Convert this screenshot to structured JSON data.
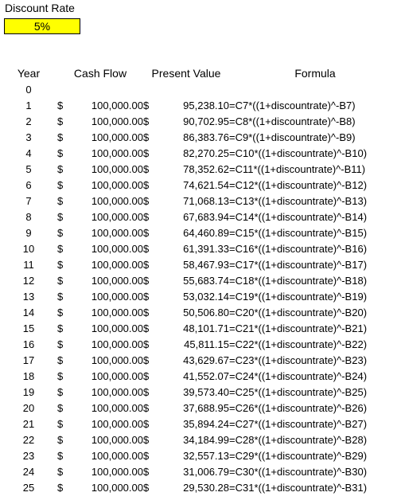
{
  "discount": {
    "label": "Discount Rate",
    "value": "5%",
    "cell_fill": "#ffff00",
    "cell_border": "#000000"
  },
  "table": {
    "headers": {
      "year": "Year",
      "cash_flow": "Cash Flow",
      "present_value": "Present Value",
      "formula": "Formula"
    },
    "currency_symbol": "$",
    "rows": [
      {
        "year": "0",
        "cash_flow": "",
        "present_value": "",
        "formula": ""
      },
      {
        "year": "1",
        "cash_flow": "100,000.00",
        "present_value": "95,238.10",
        "formula": "=C7*((1+discountrate)^-B7)"
      },
      {
        "year": "2",
        "cash_flow": "100,000.00",
        "present_value": "90,702.95",
        "formula": "=C8*((1+discountrate)^-B8)"
      },
      {
        "year": "3",
        "cash_flow": "100,000.00",
        "present_value": "86,383.76",
        "formula": "=C9*((1+discountrate)^-B9)"
      },
      {
        "year": "4",
        "cash_flow": "100,000.00",
        "present_value": "82,270.25",
        "formula": "=C10*((1+discountrate)^-B10)"
      },
      {
        "year": "5",
        "cash_flow": "100,000.00",
        "present_value": "78,352.62",
        "formula": "=C11*((1+discountrate)^-B11)"
      },
      {
        "year": "6",
        "cash_flow": "100,000.00",
        "present_value": "74,621.54",
        "formula": "=C12*((1+discountrate)^-B12)"
      },
      {
        "year": "7",
        "cash_flow": "100,000.00",
        "present_value": "71,068.13",
        "formula": "=C13*((1+discountrate)^-B13)"
      },
      {
        "year": "8",
        "cash_flow": "100,000.00",
        "present_value": "67,683.94",
        "formula": "=C14*((1+discountrate)^-B14)"
      },
      {
        "year": "9",
        "cash_flow": "100,000.00",
        "present_value": "64,460.89",
        "formula": "=C15*((1+discountrate)^-B15)"
      },
      {
        "year": "10",
        "cash_flow": "100,000.00",
        "present_value": "61,391.33",
        "formula": "=C16*((1+discountrate)^-B16)"
      },
      {
        "year": "11",
        "cash_flow": "100,000.00",
        "present_value": "58,467.93",
        "formula": "=C17*((1+discountrate)^-B17)"
      },
      {
        "year": "12",
        "cash_flow": "100,000.00",
        "present_value": "55,683.74",
        "formula": "=C18*((1+discountrate)^-B18)"
      },
      {
        "year": "13",
        "cash_flow": "100,000.00",
        "present_value": "53,032.14",
        "formula": "=C19*((1+discountrate)^-B19)"
      },
      {
        "year": "14",
        "cash_flow": "100,000.00",
        "present_value": "50,506.80",
        "formula": "=C20*((1+discountrate)^-B20)"
      },
      {
        "year": "15",
        "cash_flow": "100,000.00",
        "present_value": "48,101.71",
        "formula": "=C21*((1+discountrate)^-B21)"
      },
      {
        "year": "16",
        "cash_flow": "100,000.00",
        "present_value": "45,811.15",
        "formula": "=C22*((1+discountrate)^-B22)"
      },
      {
        "year": "17",
        "cash_flow": "100,000.00",
        "present_value": "43,629.67",
        "formula": "=C23*((1+discountrate)^-B23)"
      },
      {
        "year": "18",
        "cash_flow": "100,000.00",
        "present_value": "41,552.07",
        "formula": "=C24*((1+discountrate)^-B24)"
      },
      {
        "year": "19",
        "cash_flow": "100,000.00",
        "present_value": "39,573.40",
        "formula": "=C25*((1+discountrate)^-B25)"
      },
      {
        "year": "20",
        "cash_flow": "100,000.00",
        "present_value": "37,688.95",
        "formula": "=C26*((1+discountrate)^-B26)"
      },
      {
        "year": "21",
        "cash_flow": "100,000.00",
        "present_value": "35,894.24",
        "formula": "=C27*((1+discountrate)^-B27)"
      },
      {
        "year": "22",
        "cash_flow": "100,000.00",
        "present_value": "34,184.99",
        "formula": "=C28*((1+discountrate)^-B28)"
      },
      {
        "year": "23",
        "cash_flow": "100,000.00",
        "present_value": "32,557.13",
        "formula": "=C29*((1+discountrate)^-B29)"
      },
      {
        "year": "24",
        "cash_flow": "100,000.00",
        "present_value": "31,006.79",
        "formula": "=C30*((1+discountrate)^-B30)"
      },
      {
        "year": "25",
        "cash_flow": "100,000.00",
        "present_value": "29,530.28",
        "formula": "=C31*((1+discountrate)^-B31)"
      }
    ]
  }
}
